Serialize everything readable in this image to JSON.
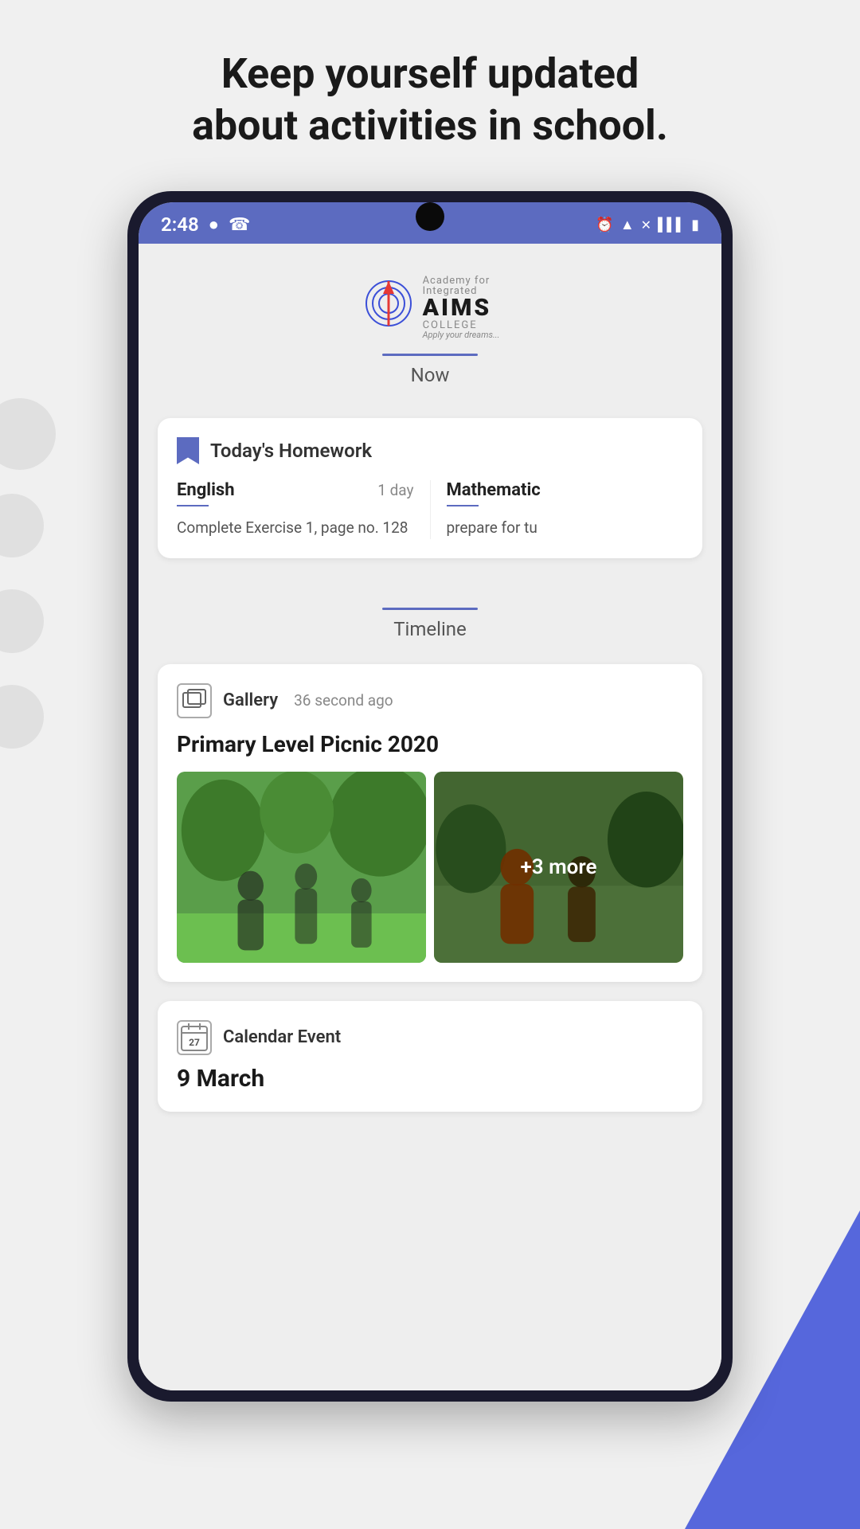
{
  "page": {
    "header_line1": "Keep yourself updated",
    "header_line2": "about activities in school."
  },
  "status_bar": {
    "time": "2:48",
    "icons_left": [
      "notification-dot-icon",
      "viber-icon"
    ],
    "icons_right": [
      "alarm-icon",
      "wifi-icon",
      "signal-icon",
      "battery-icon"
    ]
  },
  "app": {
    "logo_text": "AIMS",
    "logo_college": "COLLEGE",
    "logo_tagline": "Apply your dreams...",
    "now_tab_label": "Now",
    "timeline_tab_label": "Timeline"
  },
  "homework_card": {
    "title": "Today's Homework",
    "subjects": [
      {
        "name": "English",
        "days": "1 day",
        "description": "Complete Exercise 1, page no. 128"
      },
      {
        "name": "Mathematic",
        "days": "",
        "description": "prepare for tu"
      }
    ]
  },
  "timeline_card": {
    "type": "Gallery",
    "time_ago": "36 second ago",
    "event_title": "Primary Level Picnic 2020",
    "more_count": "+3 more"
  },
  "calendar_card": {
    "type": "Calendar Event",
    "date": "9 March",
    "icon_num": "27"
  }
}
